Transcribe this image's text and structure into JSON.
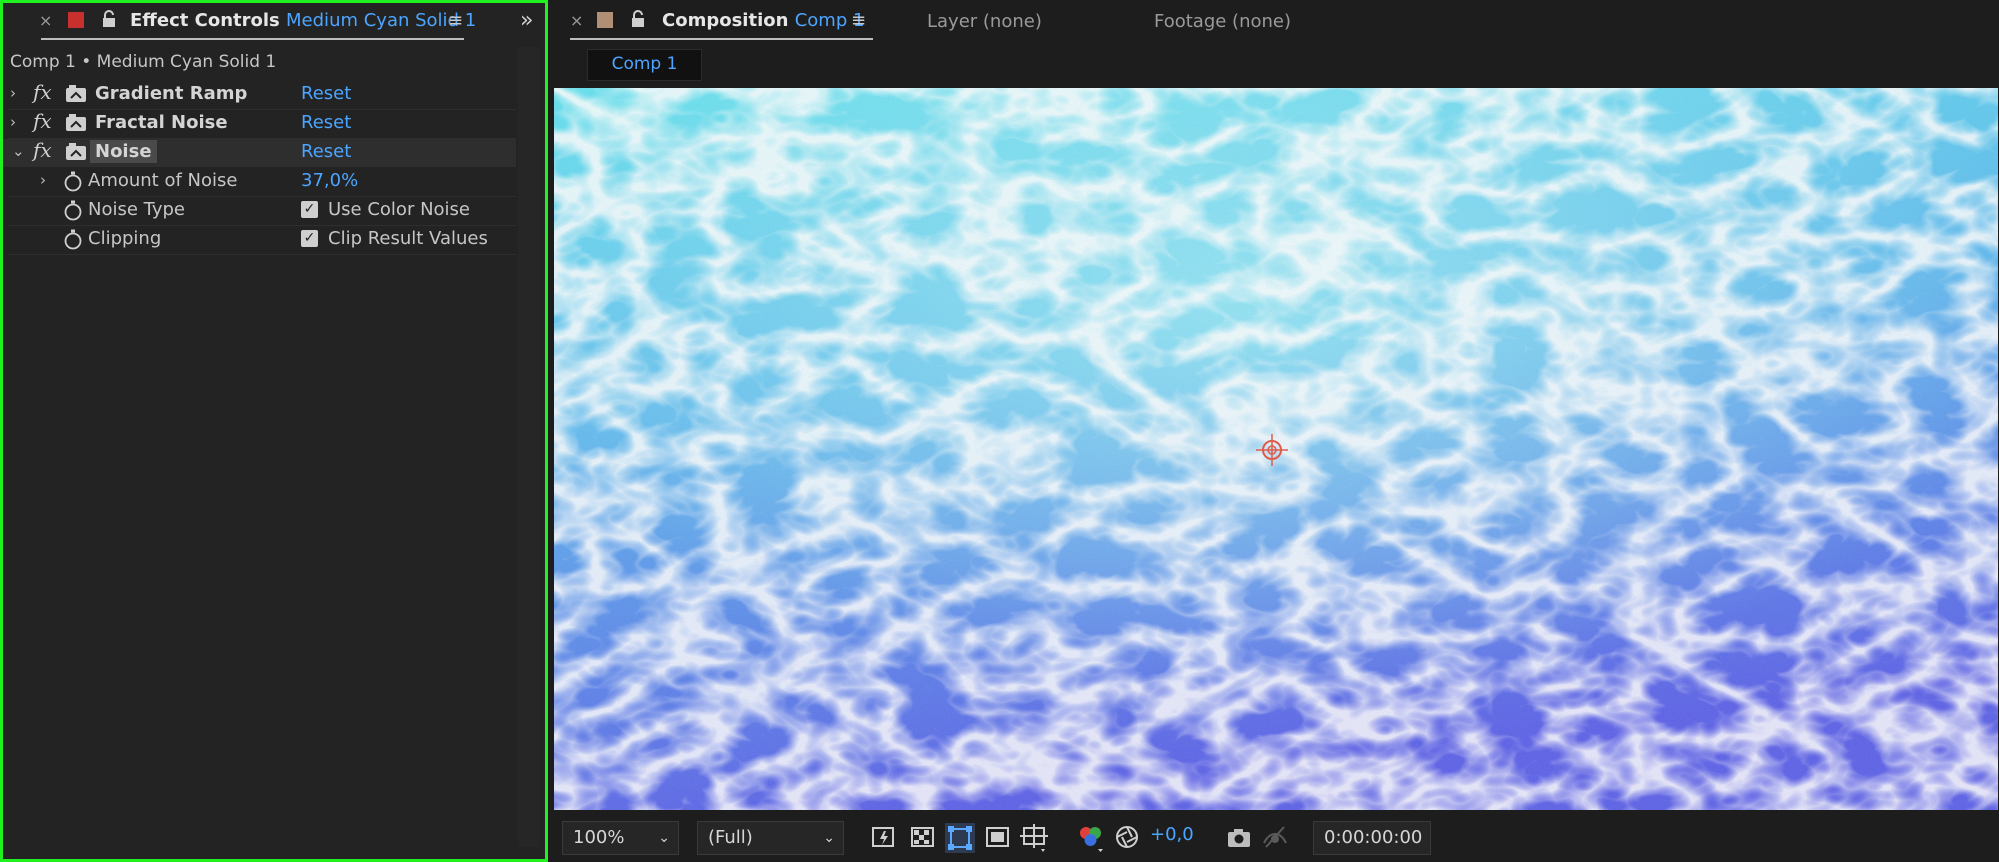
{
  "effect_controls": {
    "close": "×",
    "tab_title": "Effect Controls",
    "tab_layer": "Medium Cyan Solid 1",
    "menu": "≡",
    "expand": "»",
    "breadcrumb": "Comp 1 • Medium Cyan Solid 1",
    "effects": [
      {
        "name": "Gradient Ramp",
        "reset": "Reset",
        "fx": "fx",
        "expanded": false
      },
      {
        "name": "Fractal Noise",
        "reset": "Reset",
        "fx": "fx",
        "expanded": false
      },
      {
        "name": "Noise",
        "reset": "Reset",
        "fx": "fx",
        "expanded": true
      }
    ],
    "params": [
      {
        "name": "Amount of Noise",
        "value": "37,0%"
      },
      {
        "name": "Noise Type",
        "value": "Use Color Noise",
        "checked": true
      },
      {
        "name": "Clipping",
        "value": "Clip Result Values",
        "checked": true
      }
    ],
    "swatch_color": "#c8302d"
  },
  "composition": {
    "close": "×",
    "tab_title": "Composition",
    "tab_comp": "Comp 1",
    "menu": "≡",
    "layer_tab": "Layer (none)",
    "footage_tab": "Footage (none)",
    "comp_subtab": "Comp 1",
    "swatch_color": "#b08f74"
  },
  "viewer_bar": {
    "zoom": "100%",
    "resolution": "(Full)",
    "exposure": "+0,0",
    "timecode": "0:00:00:00"
  },
  "icons": [
    "lock-icon",
    "fx-icon",
    "stopwatch-icon",
    "checkbox-icon",
    "chevron-right-icon",
    "chevron-down-icon",
    "snapshot-icon",
    "target-icon",
    "grid-icon",
    "mask-icon",
    "color-channel-icon",
    "reset-exposure-icon"
  ]
}
